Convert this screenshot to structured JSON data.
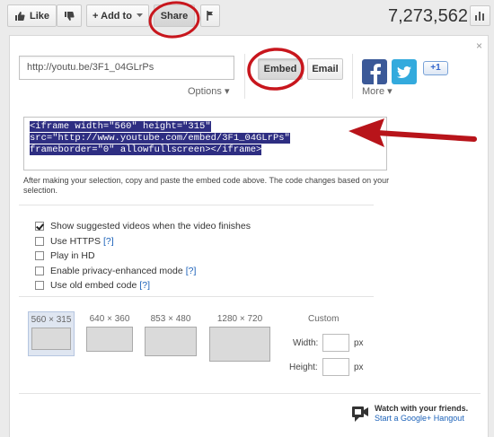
{
  "toolbar": {
    "like_label": "Like",
    "add_to_label": "+ Add to",
    "share_label": "Share",
    "view_count": "7,273,562"
  },
  "share_panel": {
    "close_label": "×",
    "url_value": "http://youtu.be/3F1_04GLrPs",
    "options_label": "Options ▾",
    "embed_label": "Embed",
    "email_label": "Email",
    "gplus_label": "+1",
    "more_label": "More ▾"
  },
  "embed": {
    "code_lines": [
      "<iframe width=\"560\" height=\"315\"",
      "src=\"http://www.youtube.com/embed/3F1_04GLrPs\"",
      "frameborder=\"0\" allowfullscreen></iframe>"
    ],
    "help_text": "After making your selection, copy and paste the embed code above. The code changes based on your selection.",
    "options": [
      {
        "label": "Show suggested videos when the video finishes",
        "checked": true,
        "hint": ""
      },
      {
        "label": "Use HTTPS",
        "checked": false,
        "hint": "[?]"
      },
      {
        "label": "Play in HD",
        "checked": false,
        "hint": ""
      },
      {
        "label": "Enable privacy-enhanced mode",
        "checked": false,
        "hint": "[?]"
      },
      {
        "label": "Use old embed code",
        "checked": false,
        "hint": "[?]"
      }
    ],
    "sizes": [
      {
        "label": "560 × 315",
        "selected": true
      },
      {
        "label": "640 × 360",
        "selected": false
      },
      {
        "label": "853 × 480",
        "selected": false
      },
      {
        "label": "1280 × 720",
        "selected": false
      }
    ],
    "custom": {
      "title": "Custom",
      "width_label": "Width:",
      "height_label": "Height:",
      "unit": "px",
      "width_value": "",
      "height_value": ""
    }
  },
  "hangout": {
    "title": "Watch with your friends.",
    "link": "Start a Google+ Hangout"
  },
  "colors": {
    "annotation_red": "#c8161d",
    "code_highlight": "#2e2e82",
    "facebook": "#3b5998",
    "twitter": "#33aadd",
    "link_blue": "#1c62b9"
  }
}
